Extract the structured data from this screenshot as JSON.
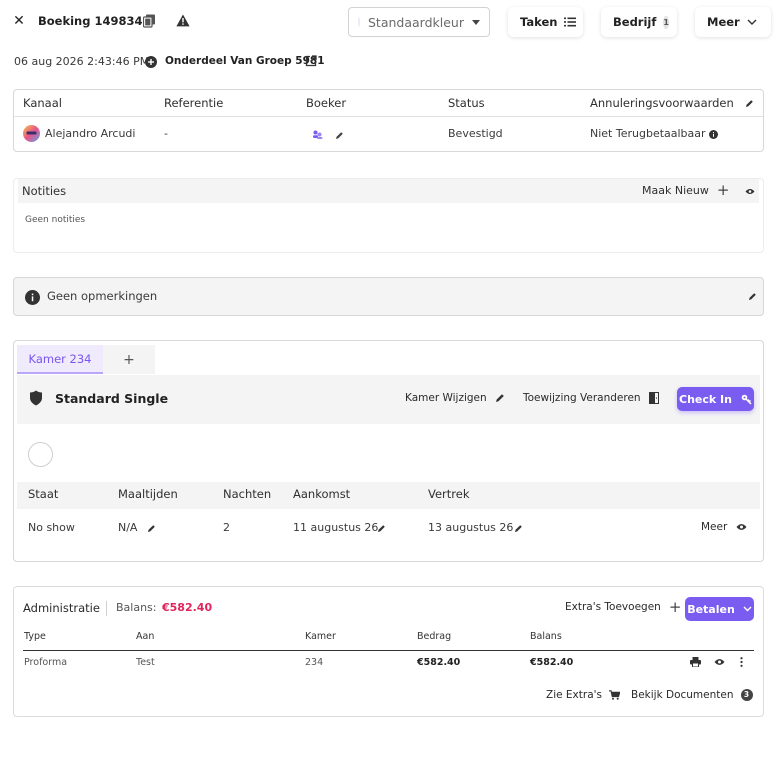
{
  "header": {
    "close_icon": "close-icon",
    "title": "Boeking 1498346",
    "copy_icon": "copy-icon",
    "warning_icon": "warning-icon",
    "color_select": {
      "value": "Standaardkleur"
    },
    "buttons": {
      "taken": "Taken",
      "bedrijf": "Bedrijf",
      "bedrijf_count": "1",
      "meer": "Meer"
    }
  },
  "meta": {
    "datetime": "06 aug 2026 2:43:46 PM",
    "group_label": "Onderdeel Van Groep 5981"
  },
  "booking_table": {
    "headers": [
      "Kanaal",
      "Referentie",
      "Boeker",
      "Status",
      "Annuleringsvoorwaarden"
    ],
    "row": {
      "kanaal": "Alejandro Arcudi",
      "referentie": "-",
      "status": "Bevestigd",
      "annulering": "Niet Terugbetaalbaar"
    }
  },
  "notes": {
    "title": "Notities",
    "new_label": "Maak Nieuw",
    "empty": "Geen notities"
  },
  "remarks": {
    "text": "Geen opmerkingen"
  },
  "room": {
    "tab_label": "Kamer 234",
    "tab_add": "+",
    "type": "Standard Single",
    "change_room": "Kamer Wijzigen",
    "change_assignment": "Toewijzing Veranderen",
    "check_in": "Check In",
    "stay_headers": [
      "Staat",
      "Maaltijden",
      "Nachten",
      "Aankomst",
      "Vertrek"
    ],
    "stay_row": {
      "staat": "No show",
      "maaltijden": "N/A",
      "nachten": "2",
      "aankomst": "11 augustus 26",
      "vertrek": "13 augustus 26",
      "meer": "Meer"
    }
  },
  "admin": {
    "title": "Administratie",
    "balance_label": "Balans:",
    "balance_value": "€582.40",
    "extras_add": "Extra's Toevoegen",
    "pay": "Betalen",
    "headers": [
      "Type",
      "Aan",
      "Kamer",
      "Bedrag",
      "Balans"
    ],
    "row": {
      "type": "Proforma",
      "aan": "Test",
      "kamer": "234",
      "bedrag": "€582.40",
      "balans": "€582.40"
    },
    "see_extras": "Zie Extra's",
    "view_documents": "Bekijk Documenten",
    "documents_count": "3"
  },
  "colors": {
    "accent": "#7b5cf0",
    "accent_light": "#efeafc",
    "balance": "#e0245e",
    "panel": "#f4f4f5"
  }
}
